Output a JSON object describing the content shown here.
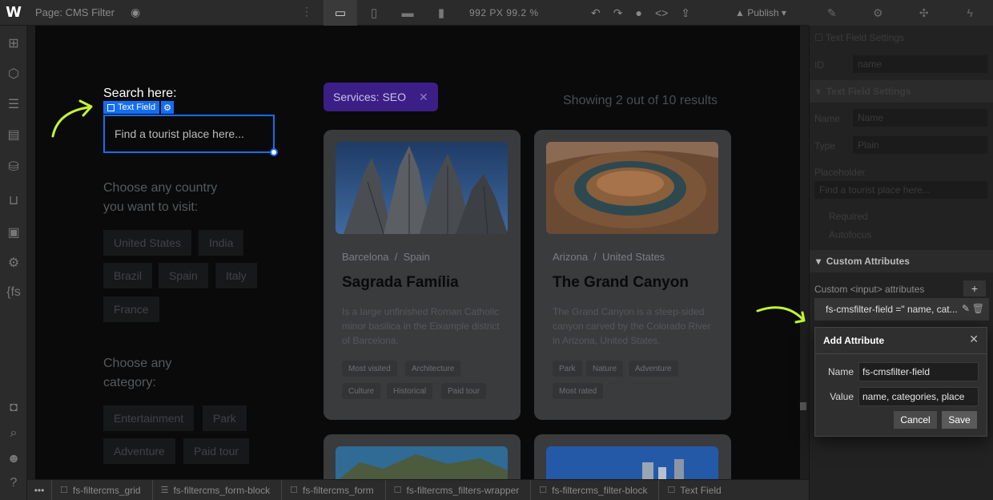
{
  "topbar": {
    "logo": "W",
    "page_label": "Page: CMS Filter",
    "viewport": "992 PX  99.2 %",
    "publish": "Publish"
  },
  "canvas": {
    "search_title": "Search here:",
    "selected_tag": "Text Field",
    "search_placeholder": "Find a tourist place here...",
    "country_question": "Choose any country you want to visit:",
    "countries": [
      "United States",
      "India",
      "Brazil",
      "Spain",
      "Italy",
      "France"
    ],
    "category_question": "Choose any category:",
    "categories": [
      "Entertainment",
      "Park",
      "Adventure",
      "Paid tour"
    ],
    "active_filter": "Services: SEO",
    "results_text": "Showing 2 out of 10 results",
    "cards": [
      {
        "location_city": "Barcelona",
        "location_country": "Spain",
        "title": "Sagrada Família",
        "description": "Is a large unfinished Roman Catholic minor basilica in the Eixample district of Barcelona.",
        "tags": [
          "Most visited",
          "Architecture",
          "Culture",
          "Historical",
          "Paid tour"
        ]
      },
      {
        "location_city": "Arizona",
        "location_country": "United States",
        "title": "The Grand Canyon",
        "description": "The Grand Canyon is a steep-sided canyon carved by the Colorado River in Arizona, United States.",
        "tags": [
          "Park",
          "Nature",
          "Adventure",
          "Most rated"
        ]
      }
    ]
  },
  "breadcrumbs": [
    "fs-filtercms_grid",
    "fs-filtercms_form-block",
    "fs-filtercms_form",
    "fs-filtercms_filters-wrapper",
    "fs-filtercms_filter-block",
    "Text Field"
  ],
  "right_panel": {
    "section_text_field": "Text Field Settings",
    "id_label": "ID",
    "id_value": "name",
    "settings_header": "Text Field Settings",
    "name_label": "Name",
    "name_value": "Name",
    "type_label": "Type",
    "type_value": "Plain",
    "placeholder_label": "Placeholder",
    "placeholder_value": "Find a tourist place here...",
    "required_label": "Required",
    "autofocus_label": "Autofocus",
    "custom_attributes_header": "Custom Attributes",
    "custom_input_label": "Custom <input> attributes",
    "attribute_row": "fs-cmsfilter-field =\" name, cat..."
  },
  "modal": {
    "title": "Add Attribute",
    "name_label": "Name",
    "name_value": "fs-cmsfilter-field",
    "value_label": "Value",
    "value_value": "name, categories, place",
    "cancel": "Cancel",
    "save": "Save"
  },
  "colors": {
    "selection_blue": "#146ef5",
    "filter_tag_purple": "#3b1f86",
    "arrow_green": "#c6f432"
  }
}
